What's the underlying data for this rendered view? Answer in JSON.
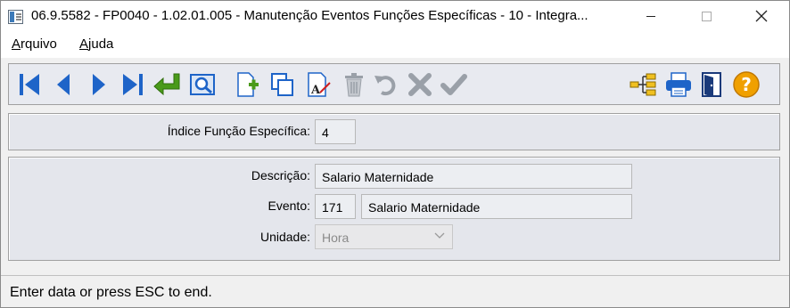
{
  "window": {
    "title": "06.9.5582 - FP0040 - 1.02.01.005 - Manutenção Eventos Funções Específicas - 10 - Integra..."
  },
  "menu": {
    "items": [
      {
        "label": "Arquivo"
      },
      {
        "label": "Ajuda"
      }
    ]
  },
  "toolbar": {
    "buttons": [
      {
        "name": "first-record",
        "icon": "skip-first-icon"
      },
      {
        "name": "previous-record",
        "icon": "prev-icon"
      },
      {
        "name": "next-record",
        "icon": "next-icon"
      },
      {
        "name": "last-record",
        "icon": "skip-last-icon"
      },
      {
        "name": "goto",
        "icon": "enter-arrow-icon"
      },
      {
        "name": "search",
        "icon": "zoom-icon"
      },
      {
        "name": "new",
        "icon": "new-document-icon"
      },
      {
        "name": "copy",
        "icon": "copy-icon"
      },
      {
        "name": "edit",
        "icon": "edit-document-icon"
      },
      {
        "name": "delete",
        "icon": "trash-icon"
      },
      {
        "name": "undo",
        "icon": "undo-icon"
      },
      {
        "name": "cancel",
        "icon": "cancel-x-icon"
      },
      {
        "name": "save",
        "icon": "checkmark-icon"
      },
      {
        "name": "hierarchy",
        "icon": "tree-icon"
      },
      {
        "name": "print",
        "icon": "printer-icon"
      },
      {
        "name": "exit",
        "icon": "exit-door-icon"
      },
      {
        "name": "help",
        "icon": "question-icon"
      }
    ],
    "colors": {
      "primary_blue": "#1e64c8",
      "green": "#4a9a1a",
      "gray": "#9aa0a8",
      "help_orange": "#f0a000"
    }
  },
  "form": {
    "indice": {
      "label": "Índice Função Específica:",
      "value": "4"
    },
    "descricao": {
      "label": "Descrição:",
      "value": "Salario Maternidade"
    },
    "evento": {
      "label": "Evento:",
      "code": "171",
      "description": "Salario Maternidade"
    },
    "unidade": {
      "label": "Unidade:",
      "value": "Hora"
    }
  },
  "status": {
    "text": "Enter data or press ESC to end."
  }
}
